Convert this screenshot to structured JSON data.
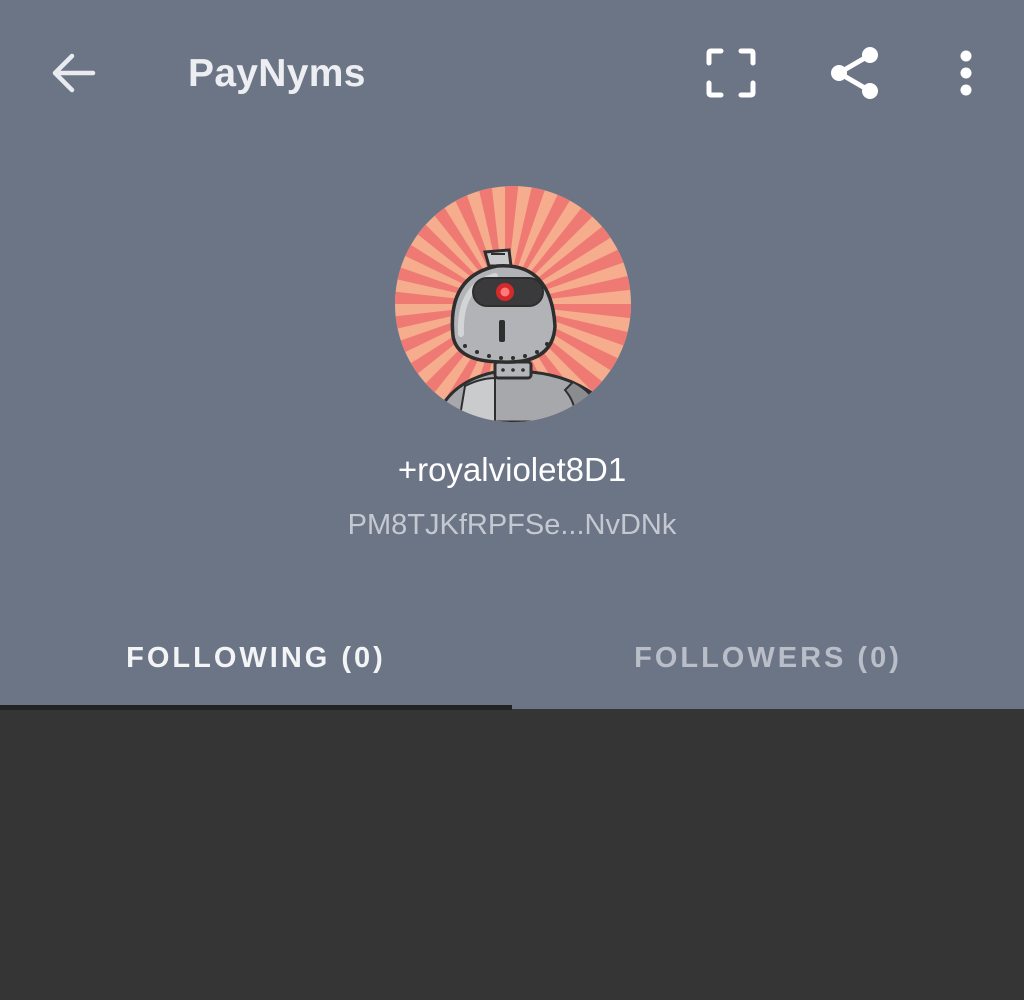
{
  "toolbar": {
    "title": "PayNyms",
    "back_icon": "arrow-left-icon",
    "scan_icon": "scan-frame-icon",
    "share_icon": "share-icon",
    "more_icon": "more-vertical-icon"
  },
  "profile": {
    "nym_name": "+royalviolet8D1",
    "payment_code": "PM8TJKfRPFSe...NvDNk",
    "avatar_icon": "robot-avatar-icon"
  },
  "tabs": [
    {
      "label": "FOLLOWING (0)",
      "active": true
    },
    {
      "label": "FOLLOWERS (0)",
      "active": false
    }
  ],
  "colors": {
    "header_bg": "#6c7586",
    "content_bg": "#353535",
    "indicator": "#222222",
    "avatar_ray_light": "#f7b08f",
    "avatar_ray_dark": "#ef7a74"
  }
}
